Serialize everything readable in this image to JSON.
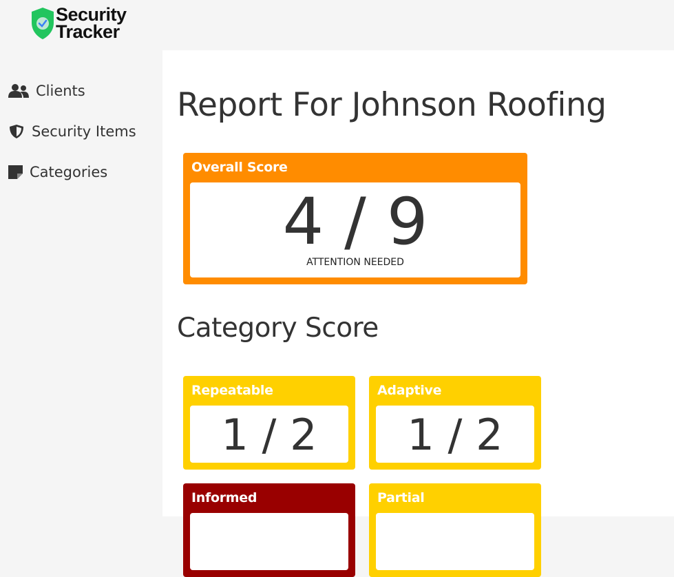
{
  "app": {
    "logo_line1": "Security",
    "logo_line2": "Tracker",
    "brand_color": "#22c55e"
  },
  "sidebar": {
    "items": [
      {
        "label": "Clients",
        "icon": "users-icon"
      },
      {
        "label": "Security Items",
        "icon": "shield-icon"
      },
      {
        "label": "Categories",
        "icon": "sticky-note-icon"
      }
    ]
  },
  "main": {
    "title": "Report For Johnson Roofing",
    "overall": {
      "label": "Overall Score",
      "score": "4 / 9",
      "status": "ATTENTION NEEDED",
      "color": "#ff8c00"
    },
    "category_section_title": "Category Score",
    "categories": [
      {
        "label": "Repeatable",
        "score": "1 / 2",
        "color": "#ffd000"
      },
      {
        "label": "Adaptive",
        "score": "1 / 2",
        "color": "#ffd000"
      },
      {
        "label": "Informed",
        "score": "",
        "color": "#990000"
      },
      {
        "label": "Partial",
        "score": "",
        "color": "#ffd000"
      }
    ]
  }
}
